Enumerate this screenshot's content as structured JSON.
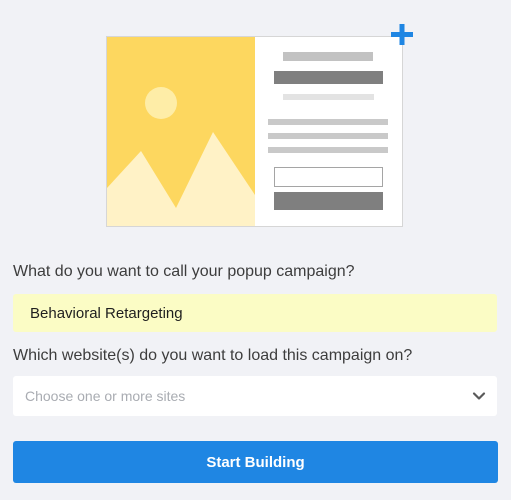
{
  "illustration": {
    "icons": [
      "image-placeholder-icon",
      "plus-icon"
    ],
    "colors": {
      "image_bg": "#fdd75f",
      "sun": "#feeda7",
      "mountains": "#fff2c6",
      "plus": "#1f86e3",
      "bars": "#c9c9c9",
      "dark_bars": "#7f7f7f"
    }
  },
  "form": {
    "name_question": "What do you want to call your popup campaign?",
    "name_value": "Behavioral Retargeting",
    "site_question": "Which website(s) do you want to load this campaign on?",
    "site_placeholder": "Choose one or more sites",
    "site_icon": "chevron-down-icon",
    "start_button_label": "Start Building"
  },
  "colors": {
    "page_bg": "#f1f2f6",
    "input_highlight": "#fbfcc5",
    "primary": "#1f86e3"
  }
}
